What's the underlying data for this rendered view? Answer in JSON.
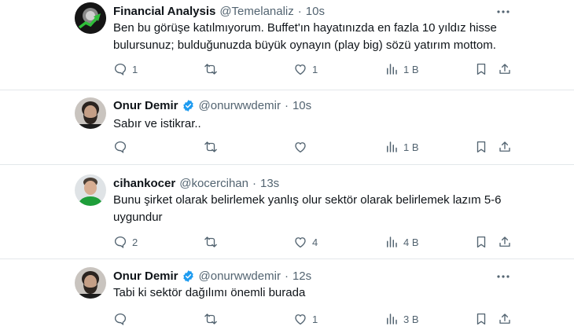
{
  "tweets": [
    {
      "name": "Financial Analysis",
      "handle": "@Temelanaliz",
      "separator": "·",
      "time": "10s",
      "verified": false,
      "text": "Ben bu görüşe katılmıyorum. Buffet'ın hayatınızda en fazla 10 yıldız hisse bulursunuz; bulduğunuzda büyük oynayın (play big) sözü yatırım mottom.",
      "replies": "1",
      "retweets": "",
      "likes": "1",
      "views": "1 B",
      "avatar": "chart-logo"
    },
    {
      "name": "Onur Demir",
      "handle": "@onurwwdemir",
      "separator": "·",
      "time": "10s",
      "verified": true,
      "text": "Sabır ve istikrar..",
      "replies": "",
      "retweets": "",
      "likes": "",
      "views": "1 B",
      "avatar": "bearded-man-photo"
    },
    {
      "name": "cihankocer",
      "handle": "@kocercihan",
      "separator": "·",
      "time": "13s",
      "verified": false,
      "text": "Bunu şirket olarak belirlemek yanlış olur sektör olarak belirlemek lazım 5-6 uygundur",
      "replies": "2",
      "retweets": "",
      "likes": "4",
      "views": "4 B",
      "avatar": "man-photo"
    },
    {
      "name": "Onur Demir",
      "handle": "@onurwwdemir",
      "separator": "·",
      "time": "12s",
      "verified": true,
      "text": "Tabi ki sektör dağılımı önemli burada",
      "replies": "",
      "retweets": "",
      "likes": "1",
      "views": "3 B",
      "avatar": "bearded-man-photo"
    }
  ],
  "colors": {
    "text": "#0f1419",
    "secondary": "#536471",
    "verified": "#1d9bf0",
    "divider": "#e3e7ea"
  }
}
